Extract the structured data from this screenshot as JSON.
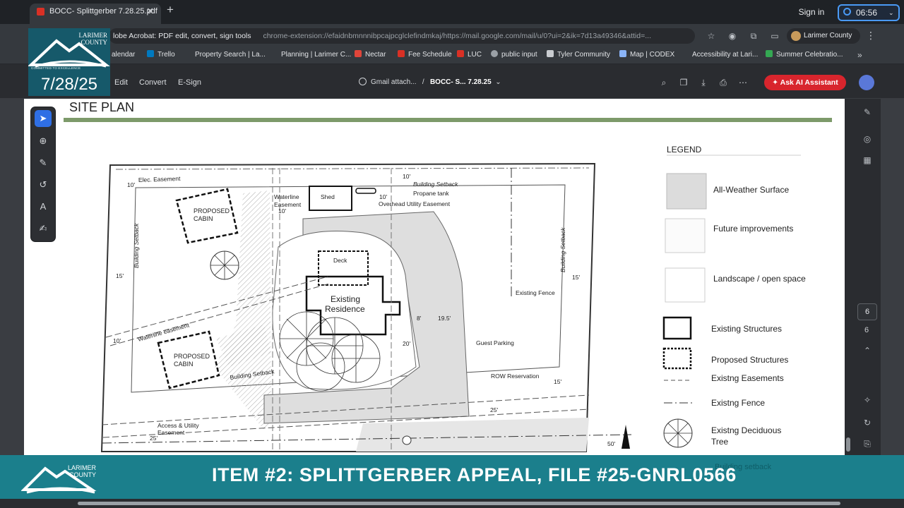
{
  "browser": {
    "tab_title": "BOCC- Splittgerber 7.28.25.pdf",
    "tab_close": "✕",
    "new_tab": "+",
    "sign_in": "Sign in",
    "clock": "06:56",
    "extension_label": "lobe Acrobat: PDF edit, convert, sign tools",
    "url": "chrome-extension://efaidnbmnnnibpcajpcglclefindmkaj/https://mail.google.com/mail/u/0?ui=2&ik=7d13a49346&attid=...",
    "profile_name": "Larimer County",
    "bookmarks": [
      {
        "label": "alendar",
        "color": "#4285f4"
      },
      {
        "label": "Trello",
        "color": "#0079bf"
      },
      {
        "label": "Property Search | La...",
        "color": ""
      },
      {
        "label": "Planning | Larimer C...",
        "color": ""
      },
      {
        "label": "Nectar",
        "color": "#e0453a"
      },
      {
        "label": "Fee Schedule",
        "color": "#d93025"
      },
      {
        "label": "LUC",
        "color": "#d93025"
      },
      {
        "label": "public input",
        "color": "#9aa0a6"
      },
      {
        "label": "Tyler Community",
        "color": "#c9ccd0"
      },
      {
        "label": "Map | CODEX",
        "color": "#8ab4f8"
      },
      {
        "label": "Accessibility at Lari...",
        "color": ""
      },
      {
        "label": "Summer Celebratio...",
        "color": "#34a853"
      }
    ],
    "bookmarks_more": "»"
  },
  "overlay": {
    "logo_text_line1": "LARIMER",
    "logo_text_line2": "COUNTY",
    "logo_tagline": "COMMITTED TO EXCELLENCE",
    "date": "7/28/25"
  },
  "acrobat": {
    "menu": [
      "Edit",
      "Convert",
      "E-Sign"
    ],
    "breadcrumb_root": "Gmail attach...",
    "breadcrumb_sep": "/",
    "breadcrumb_file": "BOCC- S... 7.28.25",
    "ai_button": "Ask AI Assistant",
    "page_current": "6",
    "page_total": "6"
  },
  "doc": {
    "title": "SITE PLAN",
    "legend_title": "LEGEND",
    "legend": [
      "All-Weather Surface",
      "Future improvements",
      "Landscape / open space",
      "Existing Structures",
      "Proposed Structures",
      "Existng Easements",
      "Existng Fence",
      "Existng Deciduous",
      "Tree",
      "Building setback"
    ],
    "plan_labels": {
      "elec_easement": "Elec. Easement",
      "waterline_easement_top": "Waterline",
      "waterline_easement_top2": "Easement",
      "shed": "Shed",
      "building_setback_top": "Building Setback",
      "propane": "Propane tank",
      "overhead": "Overhead Utility Easement",
      "proposed_cabin_1a": "PROPOSED",
      "proposed_cabin_1b": "CABIN",
      "building_setback_left": "Building Setback",
      "building_setback_right": "Building Setback",
      "deck": "Deck",
      "existing_res_a": "Existing",
      "existing_res_b": "Residence",
      "existing_fence": "Existing Fence",
      "waterline_easement": "Waterline easement",
      "proposed_cabin_2a": "PROPOSED",
      "proposed_cabin_2b": "CABIN",
      "building_setback_bottom": "Building Setback",
      "guest_parking": "Guest Parking",
      "row_reservation": "ROW Reservation",
      "access_easement_a": "Access & Utility",
      "access_easement_b": "Easement",
      "dim_10_top": "10'",
      "dim_10_a": "10'",
      "dim_10_b": "10'",
      "dim_10_c": "10'",
      "dim_15_left": "15'",
      "dim_15_right": "15'",
      "dim_8": "8'",
      "dim_19_5": "19.5'",
      "dim_20": "20'",
      "dim_10_left": "10'",
      "dim_15_bottom": "15'",
      "dim_25": "25'",
      "dim_25_b": "25'",
      "dim_50": "50'"
    }
  },
  "banner": {
    "title": "ITEM #2: SPLITTGERBER APPEAL, FILE #25-GNRL0566",
    "logo_line1": "LARIMER",
    "logo_line2": "COUNTY"
  },
  "colors": {
    "banner_bg": "#1b7f8c",
    "logo_bg": "#16596a",
    "ai_button_bg": "#d8252d",
    "accent_blue": "#2f6fe5"
  }
}
